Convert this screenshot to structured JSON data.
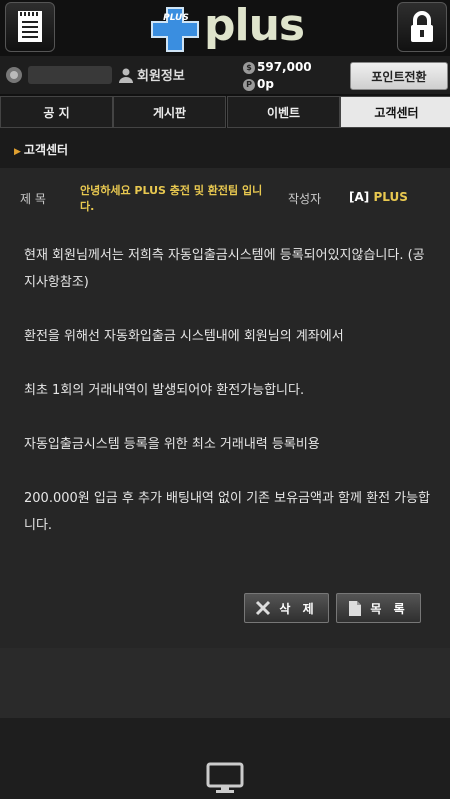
{
  "header": {
    "logo_small": "PLUS",
    "logo_text": "plus"
  },
  "user": {
    "member_info_label": "회원정보",
    "money": "597,000",
    "points": "0p",
    "point_convert_button": "포인트전환"
  },
  "tabs": [
    {
      "label": "공 지"
    },
    {
      "label": "게시판"
    },
    {
      "label": "이벤트"
    },
    {
      "label": "고객센터"
    }
  ],
  "section": {
    "title": "고객센터"
  },
  "post": {
    "title_label": "제  목",
    "title": "안녕하세요 PLUS 충전 및 환전팀 입니다.",
    "author_label": "작성자",
    "author_tag": "[A]",
    "author_name": "PLUS",
    "paragraphs": [
      "현재 회원님께서는 저희측 자동입출금시스템에 등록되어있지않습니다. (공지사항참조)",
      "환전을 위해선 자동화입출금 시스템내에 회원님의 계좌에서",
      "최초 1회의 거래내역이 발생되어야 환전가능합니다.",
      "자동입출금시스템 등록을 위한 최소 거래내력 등록비용",
      "200.000원 입금 후 추가 배팅내역 없이 기존 보유금액과 함께 환전 가능합니다."
    ],
    "delete_button": "삭 제",
    "list_button": "목 록"
  },
  "colors": {
    "accent": "#e8c850",
    "active_tab": "#e8e8e8"
  }
}
